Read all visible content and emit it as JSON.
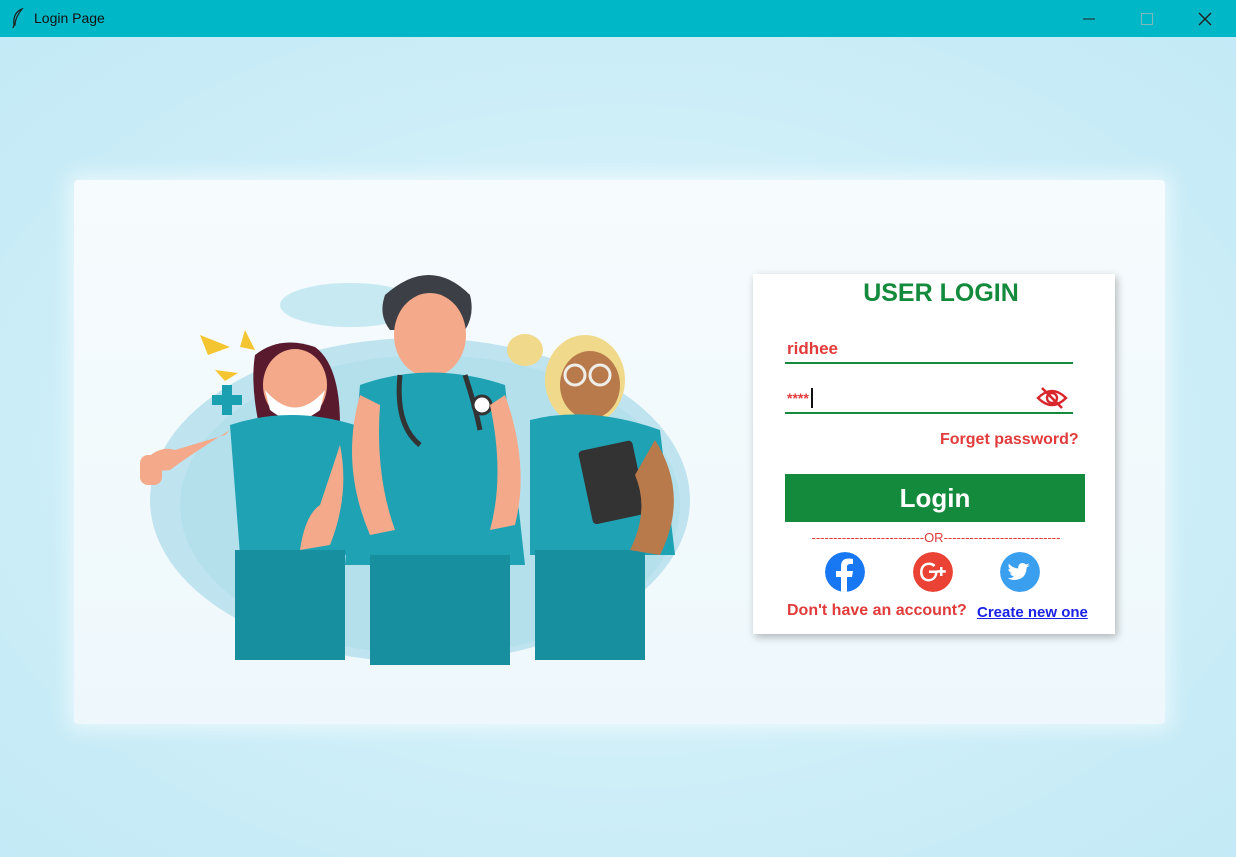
{
  "window": {
    "title": "Login Page",
    "icon": "feather-icon",
    "controls": [
      "minimize-icon",
      "maximize-icon",
      "close-icon"
    ]
  },
  "colors": {
    "titlebar": "#00b7c7",
    "accent_green": "#148a3c",
    "text_red": "#e23b3b",
    "link_blue": "#1a22e6",
    "background": "#c9edf7"
  },
  "login": {
    "title": "USER LOGIN",
    "username_value": "ridhee",
    "password_masked": "****",
    "show_password_icon": "eye-slash-icon",
    "forget_password": "Forget password?",
    "login_button": "Login",
    "or_divider": "--------------------------OR---------------------------",
    "social": [
      "facebook-icon",
      "google-plus-icon",
      "twitter-icon"
    ],
    "no_account_text": "Don't have an account?",
    "create_link": "Create new one"
  },
  "illustration": {
    "description_icon": "medical-staff-illustration"
  }
}
